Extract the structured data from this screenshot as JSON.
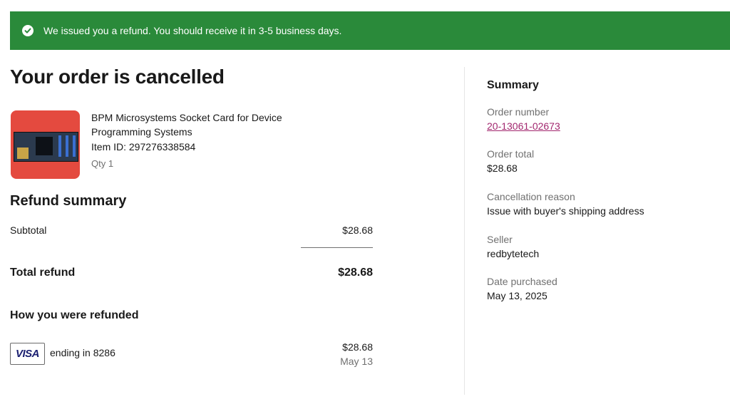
{
  "banner": {
    "message": "We issued you a refund. You should receive it in 3-5 business days.",
    "icon": "check-circle-icon",
    "color": "#2a8a3a"
  },
  "page": {
    "title": "Your order is cancelled"
  },
  "item": {
    "title": "BPM Microsystems Socket Card for Device Programming Systems",
    "item_id": "Item ID: 297276338584",
    "qty": "Qty 1"
  },
  "refund": {
    "title": "Refund summary",
    "subtotal_label": "Subtotal",
    "subtotal_value": "$28.68",
    "total_label": "Total refund",
    "total_value": "$28.68",
    "how_title": "How you were refunded",
    "card_brand": "VISA",
    "card_ending": "ending in 8286",
    "amount": "$28.68",
    "date": "May 13"
  },
  "summary": {
    "title": "Summary",
    "order_number_label": "Order number",
    "order_number": "20-13061-02673",
    "order_total_label": "Order total",
    "order_total": "$28.68",
    "reason_label": "Cancellation reason",
    "reason": "Issue with buyer's shipping address",
    "seller_label": "Seller",
    "seller": "redbytetech",
    "date_label": "Date purchased",
    "date": "May 13, 2025"
  }
}
